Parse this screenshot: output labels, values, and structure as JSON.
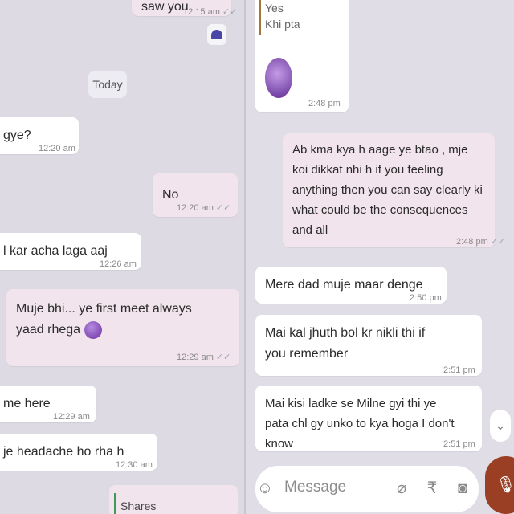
{
  "left_chat": {
    "messages": [
      {
        "id": "m1",
        "dir": "out",
        "text": "saw you",
        "time": "12:15 am",
        "ticks": true
      },
      {
        "id": "m2",
        "dir": "in",
        "text": "gye?",
        "time": "12:20 am"
      },
      {
        "id": "m3",
        "dir": "out",
        "text": "No",
        "time": "12:20 am",
        "ticks": true
      },
      {
        "id": "m4",
        "dir": "in",
        "text": "l kar acha laga aaj",
        "time": "12:26 am"
      },
      {
        "id": "m5",
        "dir": "out",
        "text": "Muje bhi... ye first meet always yaad rhega",
        "time": "12:29 am",
        "ticks": true
      },
      {
        "id": "m6",
        "dir": "in",
        "text": "me here",
        "time": "12:29 am"
      },
      {
        "id": "m7",
        "dir": "in",
        "text": "je headache ho rha h",
        "time": "12:30 am"
      }
    ],
    "day_separator": "Today",
    "shared_card_label": "Shares"
  },
  "right_chat": {
    "quoted_message": {
      "line1": "Yes",
      "line2": "Khi pta",
      "time": "2:48 pm"
    },
    "messages": [
      {
        "id": "r1",
        "dir": "out",
        "text": "Ab kma kya h aage ye btao , mje koi dikkat nhi h if you feeling anything then you can say clearly ki what could be the consequences and all",
        "time": "2:48 pm",
        "ticks": true
      },
      {
        "id": "r2",
        "dir": "in",
        "text": "Mere dad muje maar denge",
        "time": "2:50 pm"
      },
      {
        "id": "r3",
        "dir": "in",
        "text": "Mai kal jhuth bol kr nikli thi if you remember",
        "time": "2:51 pm"
      },
      {
        "id": "r4",
        "dir": "in",
        "text": "Mai kisi ladke se Milne gyi thi ye pata chl gy unko to kya hoga I don't know",
        "time": "2:51 pm"
      }
    ],
    "composer": {
      "placeholder": "Message"
    }
  },
  "colors": {
    "incoming_bubble": "#ffffff",
    "outgoing_bubble": "#f2e4ec",
    "background": "#dddae3",
    "mic_button": "#9a3f23"
  },
  "icons": [
    "heart-icon",
    "emoji-icon",
    "attach-icon",
    "rupee-icon",
    "camera-icon",
    "mic-icon",
    "chevron-down-icon",
    "check-icon"
  ]
}
